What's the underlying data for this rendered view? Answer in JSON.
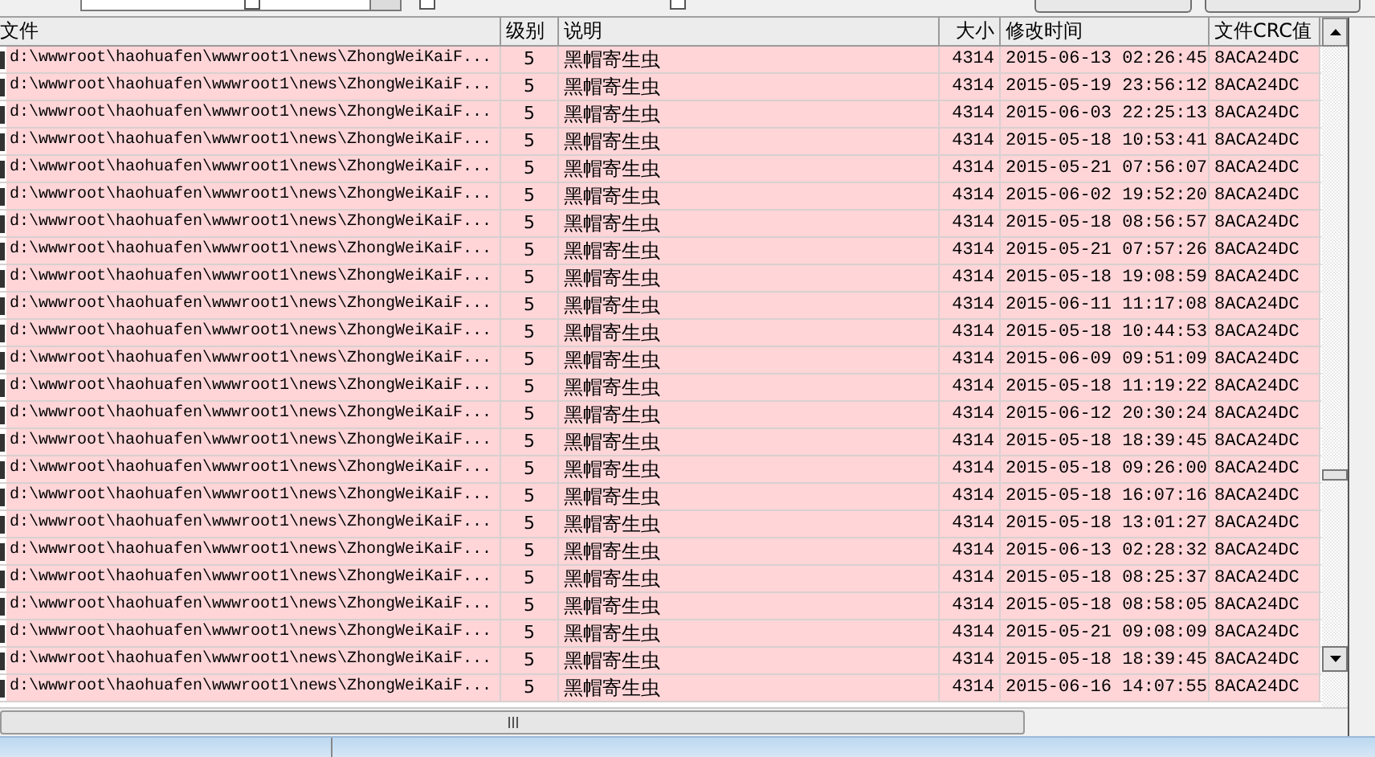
{
  "table": {
    "columns": [
      "文件",
      "级别",
      "说明",
      "大小",
      "修改时间",
      "文件CRC值"
    ],
    "rows": [
      {
        "file": "d:\\wwwroot\\haohuafen\\wwwroot1\\news\\ZhongWeiKaiF...",
        "level": "5",
        "description": "黑帽寄生虫",
        "size": "4314",
        "modified": "2015-06-13 02:26:45",
        "crc": "8ACA24DC"
      },
      {
        "file": "d:\\wwwroot\\haohuafen\\wwwroot1\\news\\ZhongWeiKaiF...",
        "level": "5",
        "description": "黑帽寄生虫",
        "size": "4314",
        "modified": "2015-05-19 23:56:12",
        "crc": "8ACA24DC"
      },
      {
        "file": "d:\\wwwroot\\haohuafen\\wwwroot1\\news\\ZhongWeiKaiF...",
        "level": "5",
        "description": "黑帽寄生虫",
        "size": "4314",
        "modified": "2015-06-03 22:25:13",
        "crc": "8ACA24DC"
      },
      {
        "file": "d:\\wwwroot\\haohuafen\\wwwroot1\\news\\ZhongWeiKaiF...",
        "level": "5",
        "description": "黑帽寄生虫",
        "size": "4314",
        "modified": "2015-05-18 10:53:41",
        "crc": "8ACA24DC"
      },
      {
        "file": "d:\\wwwroot\\haohuafen\\wwwroot1\\news\\ZhongWeiKaiF...",
        "level": "5",
        "description": "黑帽寄生虫",
        "size": "4314",
        "modified": "2015-05-21 07:56:07",
        "crc": "8ACA24DC"
      },
      {
        "file": "d:\\wwwroot\\haohuafen\\wwwroot1\\news\\ZhongWeiKaiF...",
        "level": "5",
        "description": "黑帽寄生虫",
        "size": "4314",
        "modified": "2015-06-02 19:52:20",
        "crc": "8ACA24DC"
      },
      {
        "file": "d:\\wwwroot\\haohuafen\\wwwroot1\\news\\ZhongWeiKaiF...",
        "level": "5",
        "description": "黑帽寄生虫",
        "size": "4314",
        "modified": "2015-05-18 08:56:57",
        "crc": "8ACA24DC"
      },
      {
        "file": "d:\\wwwroot\\haohuafen\\wwwroot1\\news\\ZhongWeiKaiF...",
        "level": "5",
        "description": "黑帽寄生虫",
        "size": "4314",
        "modified": "2015-05-21 07:57:26",
        "crc": "8ACA24DC"
      },
      {
        "file": "d:\\wwwroot\\haohuafen\\wwwroot1\\news\\ZhongWeiKaiF...",
        "level": "5",
        "description": "黑帽寄生虫",
        "size": "4314",
        "modified": "2015-05-18 19:08:59",
        "crc": "8ACA24DC"
      },
      {
        "file": "d:\\wwwroot\\haohuafen\\wwwroot1\\news\\ZhongWeiKaiF...",
        "level": "5",
        "description": "黑帽寄生虫",
        "size": "4314",
        "modified": "2015-06-11 11:17:08",
        "crc": "8ACA24DC"
      },
      {
        "file": "d:\\wwwroot\\haohuafen\\wwwroot1\\news\\ZhongWeiKaiF...",
        "level": "5",
        "description": "黑帽寄生虫",
        "size": "4314",
        "modified": "2015-05-18 10:44:53",
        "crc": "8ACA24DC"
      },
      {
        "file": "d:\\wwwroot\\haohuafen\\wwwroot1\\news\\ZhongWeiKaiF...",
        "level": "5",
        "description": "黑帽寄生虫",
        "size": "4314",
        "modified": "2015-06-09 09:51:09",
        "crc": "8ACA24DC"
      },
      {
        "file": "d:\\wwwroot\\haohuafen\\wwwroot1\\news\\ZhongWeiKaiF...",
        "level": "5",
        "description": "黑帽寄生虫",
        "size": "4314",
        "modified": "2015-05-18 11:19:22",
        "crc": "8ACA24DC"
      },
      {
        "file": "d:\\wwwroot\\haohuafen\\wwwroot1\\news\\ZhongWeiKaiF...",
        "level": "5",
        "description": "黑帽寄生虫",
        "size": "4314",
        "modified": "2015-06-12 20:30:24",
        "crc": "8ACA24DC"
      },
      {
        "file": "d:\\wwwroot\\haohuafen\\wwwroot1\\news\\ZhongWeiKaiF...",
        "level": "5",
        "description": "黑帽寄生虫",
        "size": "4314",
        "modified": "2015-05-18 18:39:45",
        "crc": "8ACA24DC"
      },
      {
        "file": "d:\\wwwroot\\haohuafen\\wwwroot1\\news\\ZhongWeiKaiF...",
        "level": "5",
        "description": "黑帽寄生虫",
        "size": "4314",
        "modified": "2015-05-18 09:26:00",
        "crc": "8ACA24DC"
      },
      {
        "file": "d:\\wwwroot\\haohuafen\\wwwroot1\\news\\ZhongWeiKaiF...",
        "level": "5",
        "description": "黑帽寄生虫",
        "size": "4314",
        "modified": "2015-05-18 16:07:16",
        "crc": "8ACA24DC"
      },
      {
        "file": "d:\\wwwroot\\haohuafen\\wwwroot1\\news\\ZhongWeiKaiF...",
        "level": "5",
        "description": "黑帽寄生虫",
        "size": "4314",
        "modified": "2015-05-18 13:01:27",
        "crc": "8ACA24DC"
      },
      {
        "file": "d:\\wwwroot\\haohuafen\\wwwroot1\\news\\ZhongWeiKaiF...",
        "level": "5",
        "description": "黑帽寄生虫",
        "size": "4314",
        "modified": "2015-06-13 02:28:32",
        "crc": "8ACA24DC"
      },
      {
        "file": "d:\\wwwroot\\haohuafen\\wwwroot1\\news\\ZhongWeiKaiF...",
        "level": "5",
        "description": "黑帽寄生虫",
        "size": "4314",
        "modified": "2015-05-18 08:25:37",
        "crc": "8ACA24DC"
      },
      {
        "file": "d:\\wwwroot\\haohuafen\\wwwroot1\\news\\ZhongWeiKaiF...",
        "level": "5",
        "description": "黑帽寄生虫",
        "size": "4314",
        "modified": "2015-05-18 08:58:05",
        "crc": "8ACA24DC"
      },
      {
        "file": "d:\\wwwroot\\haohuafen\\wwwroot1\\news\\ZhongWeiKaiF...",
        "level": "5",
        "description": "黑帽寄生虫",
        "size": "4314",
        "modified": "2015-05-21 09:08:09",
        "crc": "8ACA24DC"
      },
      {
        "file": "d:\\wwwroot\\haohuafen\\wwwroot1\\news\\ZhongWeiKaiF...",
        "level": "5",
        "description": "黑帽寄生虫",
        "size": "4314",
        "modified": "2015-05-18 18:39:45",
        "crc": "8ACA24DC"
      },
      {
        "file": "d:\\wwwroot\\haohuafen\\wwwroot1\\news\\ZhongWeiKaiF...",
        "level": "5",
        "description": "黑帽寄生虫",
        "size": "4314",
        "modified": "2015-06-16 14:07:55",
        "crc": "8ACA24DC"
      }
    ]
  }
}
